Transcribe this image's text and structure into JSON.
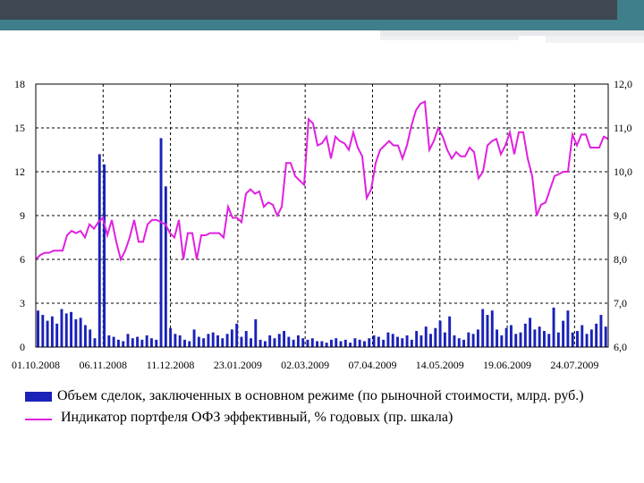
{
  "chart_data": {
    "type": "bar+line",
    "x_tick_labels": [
      "01.10.2008",
      "06.11.2008",
      "11.12.2008",
      "23.01.2009",
      "02.03.2009",
      "07.04.2009",
      "14.05.2009",
      "19.06.2009",
      "24.07.2009"
    ],
    "y_left_ticks": [
      "0",
      "3",
      "6",
      "9",
      "12",
      "15",
      "18"
    ],
    "y_right_ticks": [
      "6,0",
      "7,0",
      "8,0",
      "9,0",
      "10,0",
      "11,0",
      "12,0"
    ],
    "y_left_range": [
      0,
      18
    ],
    "y_right_range": [
      6.0,
      12.0
    ],
    "grid": "dashed vertical lines at date ticks, dashed horizontal lines at left-axis ticks",
    "colors": {
      "bars": "#1a22b8",
      "line": "#e020e0"
    },
    "series": [
      {
        "name": "Объем сделок, заключенных в основном режиме (по рыночной стоимости, млрд. руб.)",
        "type": "bar",
        "axis": "left",
        "values": [
          2.5,
          2.2,
          1.8,
          2.1,
          1.6,
          2.6,
          2.3,
          2.4,
          1.9,
          2.0,
          1.5,
          1.2,
          0.6,
          13.2,
          12.5,
          0.8,
          0.7,
          0.5,
          0.4,
          0.9,
          0.6,
          0.7,
          0.5,
          0.8,
          0.6,
          0.5,
          14.3,
          11.0,
          1.3,
          0.9,
          0.8,
          0.5,
          0.4,
          1.2,
          0.7,
          0.6,
          0.9,
          1.0,
          0.8,
          0.6,
          0.9,
          1.2,
          1.6,
          0.7,
          1.1,
          0.6,
          1.9,
          0.5,
          0.4,
          0.8,
          0.6,
          0.9,
          1.1,
          0.7,
          0.5,
          0.8,
          0.6,
          0.5,
          0.6,
          0.4,
          0.4,
          0.3,
          0.5,
          0.6,
          0.4,
          0.5,
          0.3,
          0.6,
          0.5,
          0.4,
          0.6,
          0.8,
          0.7,
          0.5,
          1.0,
          0.9,
          0.7,
          0.6,
          0.8,
          0.5,
          1.1,
          0.8,
          1.4,
          0.9,
          1.3,
          1.8,
          1.0,
          2.1,
          0.8,
          0.6,
          0.5,
          1.0,
          0.9,
          1.2,
          2.6,
          2.2,
          2.5,
          1.2,
          0.8,
          1.3,
          1.5,
          0.9,
          1.0,
          1.6,
          2.0,
          1.2,
          1.4,
          1.1,
          0.9,
          2.7,
          1.0,
          1.8,
          2.5,
          1.0,
          1.1,
          1.5,
          0.9,
          1.2,
          1.6,
          2.2,
          1.4
        ]
      },
      {
        "name": "Индикатор портфеля ОФЗ эффективный, % годовых (пр. шкала)",
        "type": "line",
        "axis": "right",
        "values": [
          8.0,
          8.1,
          8.15,
          8.15,
          8.2,
          8.2,
          8.2,
          8.55,
          8.65,
          8.6,
          8.65,
          8.5,
          8.8,
          8.7,
          8.85,
          8.95,
          8.55,
          8.9,
          8.4,
          8.0,
          8.2,
          8.5,
          8.9,
          8.4,
          8.4,
          8.8,
          8.9,
          8.9,
          8.85,
          8.8,
          8.6,
          8.5,
          8.9,
          8.0,
          8.6,
          8.6,
          8.0,
          8.55,
          8.55,
          8.6,
          8.6,
          8.6,
          8.5,
          9.2,
          8.95,
          8.95,
          8.85,
          9.5,
          9.6,
          9.5,
          9.55,
          9.2,
          9.3,
          9.25,
          9.0,
          9.2,
          10.2,
          10.2,
          9.9,
          9.8,
          9.7,
          11.2,
          11.1,
          10.6,
          10.65,
          10.8,
          10.3,
          10.8,
          10.7,
          10.65,
          10.5,
          10.9,
          10.55,
          10.35,
          9.4,
          9.6,
          10.2,
          10.5,
          10.6,
          10.7,
          10.6,
          10.6,
          10.3,
          10.6,
          11.05,
          11.4,
          11.55,
          11.6,
          10.5,
          10.7,
          11.0,
          10.8,
          10.5,
          10.3,
          10.45,
          10.35,
          10.35,
          10.55,
          10.45,
          9.85,
          10.0,
          10.6,
          10.7,
          10.75,
          10.4,
          10.6,
          10.9,
          10.4,
          10.9,
          10.9,
          10.3,
          9.9,
          9.0,
          9.25,
          9.3,
          9.6,
          9.9,
          9.95,
          10.0,
          10.0,
          10.85,
          10.6,
          10.85,
          10.85,
          10.55,
          10.55,
          10.55,
          10.8,
          10.75
        ]
      }
    ]
  },
  "legend": {
    "bar_label": "Объем сделок, заключенных в основном режиме (по рыночной стоимости, млрд. руб.)",
    "line_label": "Индикатор портфеля ОФЗ эффективный, % годовых (пр. шкала)"
  }
}
